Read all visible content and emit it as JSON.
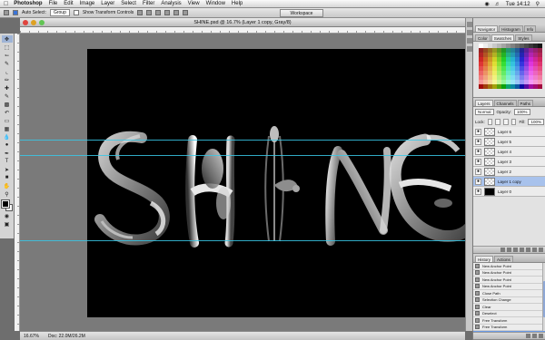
{
  "menubar": {
    "app": "Photoshop",
    "items": [
      "File",
      "Edit",
      "Image",
      "Layer",
      "Select",
      "Filter",
      "Analysis",
      "View",
      "Window",
      "Help"
    ],
    "clock": "Tue 14:12"
  },
  "options": {
    "auto_select_label": "Auto Select:",
    "auto_select_value": "Group",
    "show_transform_label": "Show Transform Controls",
    "workspace": "Workspace"
  },
  "document": {
    "title": "SHINE.psd @ 16.7% (Layer 1 copy, Gray/8)"
  },
  "statusbar": {
    "zoom": "16.67%",
    "doc": "Doc: 22.0M/26.2M"
  },
  "panels": {
    "navigator_tabs": [
      "Navigator",
      "Histogram",
      "Info"
    ],
    "swatches_tabs": [
      "Color",
      "Swatches",
      "Styles"
    ],
    "layers_tabs": [
      "Layers",
      "Channels",
      "Paths"
    ],
    "blend_mode": "Normal",
    "opacity_label": "Opacity:",
    "opacity": "100%",
    "lock_label": "Lock:",
    "fill_label": "Fill:",
    "fill": "100%",
    "layers": [
      {
        "name": "Layer 6",
        "selected": false,
        "black": false
      },
      {
        "name": "Layer 5",
        "selected": false,
        "black": false
      },
      {
        "name": "Layer 4",
        "selected": false,
        "black": false
      },
      {
        "name": "Layer 3",
        "selected": false,
        "black": false
      },
      {
        "name": "Layer 2",
        "selected": false,
        "black": false
      },
      {
        "name": "Layer 1 copy",
        "selected": true,
        "black": false
      },
      {
        "name": "Layer 0",
        "selected": false,
        "black": true
      }
    ],
    "history_tabs": [
      "History",
      "Actions"
    ],
    "history": [
      {
        "name": "New Anchor Point",
        "selected": false
      },
      {
        "name": "New Anchor Point",
        "selected": false
      },
      {
        "name": "New Anchor Point",
        "selected": false
      },
      {
        "name": "New Anchor Point",
        "selected": false
      },
      {
        "name": "Close Path",
        "selected": false
      },
      {
        "name": "Selection Change",
        "selected": false
      },
      {
        "name": "Clear",
        "selected": false
      },
      {
        "name": "Deselect",
        "selected": false
      },
      {
        "name": "Free Transform",
        "selected": false
      },
      {
        "name": "Free Transform",
        "selected": false
      },
      {
        "name": "Move",
        "selected": true
      }
    ]
  },
  "tools": [
    "move-tool",
    "marquee-tool",
    "lasso-tool",
    "quick-select-tool",
    "crop-tool",
    "eyedropper-tool",
    "healing-tool",
    "brush-tool",
    "stamp-tool",
    "history-brush-tool",
    "eraser-tool",
    "gradient-tool",
    "blur-tool",
    "dodge-tool",
    "pen-tool",
    "type-tool",
    "path-select-tool",
    "shape-tool",
    "hand-tool",
    "zoom-tool"
  ]
}
